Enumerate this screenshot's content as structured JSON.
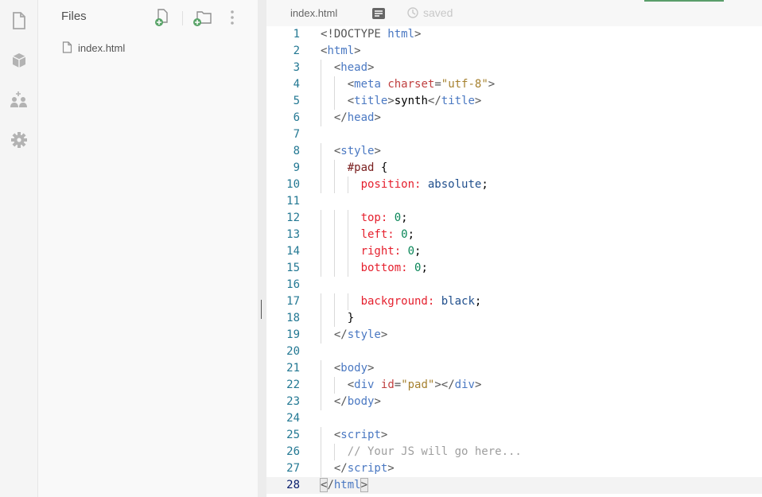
{
  "sidebar": {
    "files_title": "Files",
    "files": [
      {
        "name": "index.html"
      }
    ]
  },
  "activity_icons": [
    "file-icon",
    "package-icon",
    "add-users-icon",
    "gear-icon"
  ],
  "editor": {
    "tab_label": "index.html",
    "status": "saved",
    "active_line": 28,
    "lines": [
      {
        "n": "1",
        "indent": 0,
        "tokens": [
          [
            "t-doc",
            "<!DOCTYPE "
          ],
          [
            "t-tag",
            "html"
          ],
          [
            "t-doc",
            ">"
          ]
        ]
      },
      {
        "n": "2",
        "indent": 0,
        "tokens": [
          [
            "t-punc",
            "<"
          ],
          [
            "t-tag",
            "html"
          ],
          [
            "t-punc",
            ">"
          ]
        ]
      },
      {
        "n": "3",
        "indent": 1,
        "tokens": [
          [
            "t-punc",
            "<"
          ],
          [
            "t-tag",
            "head"
          ],
          [
            "t-punc",
            ">"
          ]
        ]
      },
      {
        "n": "4",
        "indent": 2,
        "tokens": [
          [
            "t-punc",
            "<"
          ],
          [
            "t-tag",
            "meta"
          ],
          [
            "t-text",
            " "
          ],
          [
            "t-attr",
            "charset"
          ],
          [
            "t-punc",
            "="
          ],
          [
            "t-str",
            "\"utf-8\""
          ],
          [
            "t-punc",
            ">"
          ]
        ]
      },
      {
        "n": "5",
        "indent": 2,
        "tokens": [
          [
            "t-punc",
            "<"
          ],
          [
            "t-tag",
            "title"
          ],
          [
            "t-punc",
            ">"
          ],
          [
            "t-text",
            "synth"
          ],
          [
            "t-punc",
            "</"
          ],
          [
            "t-tag",
            "title"
          ],
          [
            "t-punc",
            ">"
          ]
        ]
      },
      {
        "n": "6",
        "indent": 1,
        "tokens": [
          [
            "t-punc",
            "</"
          ],
          [
            "t-tag",
            "head"
          ],
          [
            "t-punc",
            ">"
          ]
        ]
      },
      {
        "n": "7",
        "indent": 0,
        "tokens": []
      },
      {
        "n": "8",
        "indent": 1,
        "tokens": [
          [
            "t-punc",
            "<"
          ],
          [
            "t-tag",
            "style"
          ],
          [
            "t-punc",
            ">"
          ]
        ]
      },
      {
        "n": "9",
        "indent": 2,
        "tokens": [
          [
            "t-sel",
            "#pad"
          ],
          [
            "t-text",
            " {"
          ]
        ]
      },
      {
        "n": "10",
        "indent": 3,
        "tokens": [
          [
            "t-prop",
            "position:"
          ],
          [
            "t-text",
            " "
          ],
          [
            "t-val",
            "absolute"
          ],
          [
            "t-text",
            ";"
          ]
        ]
      },
      {
        "n": "11",
        "indent": 0,
        "tokens": []
      },
      {
        "n": "12",
        "indent": 3,
        "tokens": [
          [
            "t-prop",
            "top:"
          ],
          [
            "t-text",
            " "
          ],
          [
            "t-num",
            "0"
          ],
          [
            "t-text",
            ";"
          ]
        ]
      },
      {
        "n": "13",
        "indent": 3,
        "tokens": [
          [
            "t-prop",
            "left:"
          ],
          [
            "t-text",
            " "
          ],
          [
            "t-num",
            "0"
          ],
          [
            "t-text",
            ";"
          ]
        ]
      },
      {
        "n": "14",
        "indent": 3,
        "tokens": [
          [
            "t-prop",
            "right:"
          ],
          [
            "t-text",
            " "
          ],
          [
            "t-num",
            "0"
          ],
          [
            "t-text",
            ";"
          ]
        ]
      },
      {
        "n": "15",
        "indent": 3,
        "tokens": [
          [
            "t-prop",
            "bottom:"
          ],
          [
            "t-text",
            " "
          ],
          [
            "t-num",
            "0"
          ],
          [
            "t-text",
            ";"
          ]
        ]
      },
      {
        "n": "16",
        "indent": 0,
        "tokens": []
      },
      {
        "n": "17",
        "indent": 3,
        "tokens": [
          [
            "t-prop",
            "background:"
          ],
          [
            "t-text",
            " "
          ],
          [
            "t-val",
            "black"
          ],
          [
            "t-text",
            ";"
          ]
        ]
      },
      {
        "n": "18",
        "indent": 2,
        "tokens": [
          [
            "t-text",
            "}"
          ]
        ]
      },
      {
        "n": "19",
        "indent": 1,
        "tokens": [
          [
            "t-punc",
            "</"
          ],
          [
            "t-tag",
            "style"
          ],
          [
            "t-punc",
            ">"
          ]
        ]
      },
      {
        "n": "20",
        "indent": 0,
        "tokens": []
      },
      {
        "n": "21",
        "indent": 1,
        "tokens": [
          [
            "t-punc",
            "<"
          ],
          [
            "t-tag",
            "body"
          ],
          [
            "t-punc",
            ">"
          ]
        ]
      },
      {
        "n": "22",
        "indent": 2,
        "tokens": [
          [
            "t-punc",
            "<"
          ],
          [
            "t-tag",
            "div"
          ],
          [
            "t-text",
            " "
          ],
          [
            "t-attr",
            "id"
          ],
          [
            "t-punc",
            "="
          ],
          [
            "t-str",
            "\"pad\""
          ],
          [
            "t-punc",
            "></"
          ],
          [
            "t-tag",
            "div"
          ],
          [
            "t-punc",
            ">"
          ]
        ]
      },
      {
        "n": "23",
        "indent": 1,
        "tokens": [
          [
            "t-punc",
            "</"
          ],
          [
            "t-tag",
            "body"
          ],
          [
            "t-punc",
            ">"
          ]
        ]
      },
      {
        "n": "24",
        "indent": 0,
        "tokens": []
      },
      {
        "n": "25",
        "indent": 1,
        "tokens": [
          [
            "t-punc",
            "<"
          ],
          [
            "t-tag",
            "script"
          ],
          [
            "t-punc",
            ">"
          ]
        ]
      },
      {
        "n": "26",
        "indent": 2,
        "tokens": [
          [
            "t-com",
            "// Your JS will go here..."
          ]
        ]
      },
      {
        "n": "27",
        "indent": 1,
        "tokens": [
          [
            "t-punc",
            "</"
          ],
          [
            "t-tag",
            "script"
          ],
          [
            "t-punc",
            ">"
          ]
        ]
      },
      {
        "n": "28",
        "indent": 0,
        "tokens": [
          [
            "t-punc cursor-box",
            "<"
          ],
          [
            "t-punc",
            "/"
          ],
          [
            "t-tag",
            "html"
          ],
          [
            "t-punc cursor-box",
            ">"
          ]
        ]
      }
    ]
  }
}
